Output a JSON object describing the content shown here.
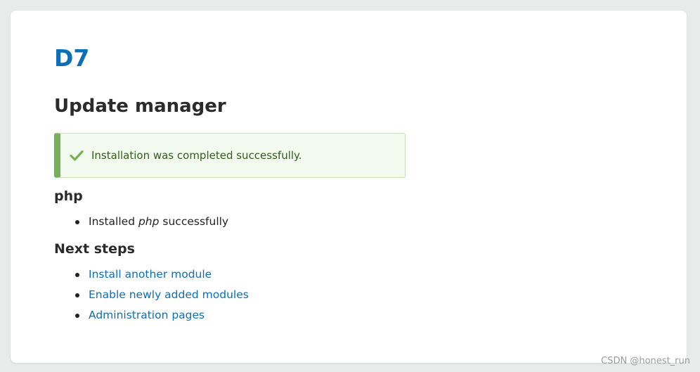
{
  "header": {
    "site_name": "D7",
    "page_title": "Update manager"
  },
  "message": {
    "icon": "check-icon",
    "text": "Installation was completed successfully.",
    "colors": {
      "background": "#f2f9ef",
      "border": "#77b259",
      "text": "#325e1c"
    }
  },
  "result": {
    "heading": "php",
    "items": [
      {
        "prefix": "Installed ",
        "name": "php",
        "suffix": " successfully"
      }
    ]
  },
  "next_steps": {
    "heading": "Next steps",
    "links": [
      {
        "label": "Install another module"
      },
      {
        "label": "Enable newly added modules"
      },
      {
        "label": "Administration pages"
      }
    ]
  },
  "watermark": "CSDN @honest_run",
  "colors": {
    "link": "#0b6fb8",
    "page_background": "#e9eaea"
  }
}
